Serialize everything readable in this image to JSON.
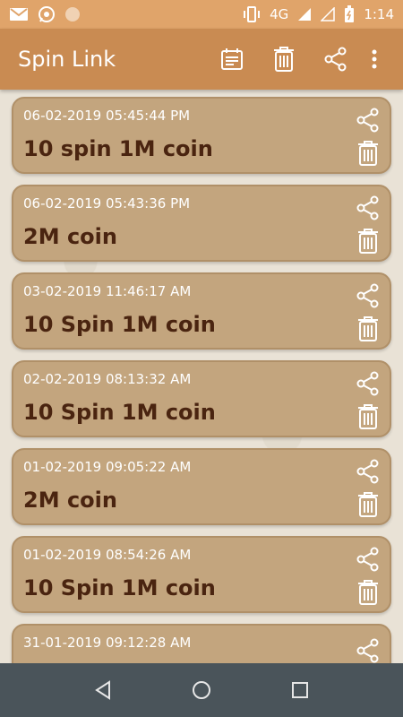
{
  "status_bar": {
    "network": "4G",
    "time": "1:14",
    "icons": [
      "gmail-icon",
      "whatsapp-icon",
      "notification-dot-icon",
      "vibrate-icon",
      "signal-icon",
      "signal-icon",
      "battery-icon"
    ]
  },
  "app_bar": {
    "title": "Spin Link",
    "actions": [
      "calendar-icon",
      "delete-all-icon",
      "share-icon",
      "more-vert-icon"
    ]
  },
  "items": [
    {
      "time": "06-02-2019 05:45:44 PM",
      "title": "10 spin 1M coin"
    },
    {
      "time": "06-02-2019 05:43:36 PM",
      "title": "2M coin"
    },
    {
      "time": "03-02-2019 11:46:17 AM",
      "title": "10 Spin 1M coin"
    },
    {
      "time": "02-02-2019 08:13:32 AM",
      "title": "10 Spin 1M coin"
    },
    {
      "time": "01-02-2019 09:05:22 AM",
      "title": "2M coin"
    },
    {
      "time": "01-02-2019 08:54:26 AM",
      "title": "10 Spin 1M coin"
    },
    {
      "time": "31-01-2019 09:12:28 AM",
      "title": ""
    }
  ],
  "nav_bar": [
    "back-icon",
    "home-icon",
    "recents-icon"
  ],
  "colors": {
    "status_bar": "#e0a46a",
    "app_bar": "#c98b52",
    "card": "#c3a57e",
    "card_title": "#4a2410",
    "nav_bar": "#4a545a"
  }
}
